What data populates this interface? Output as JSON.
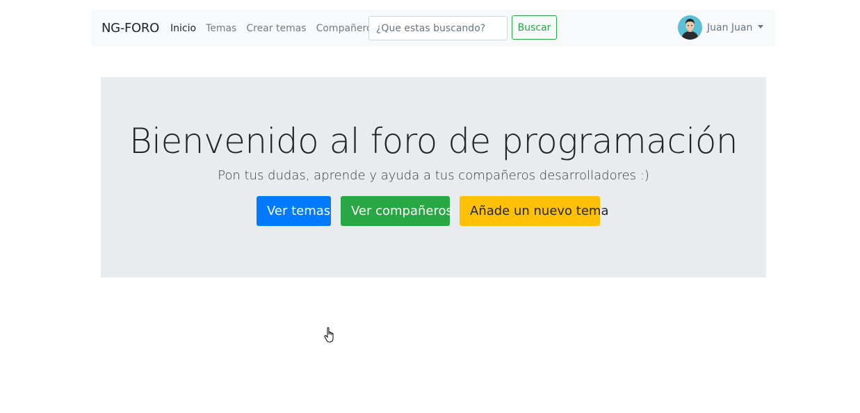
{
  "navbar": {
    "brand": "NG-FORO",
    "links": [
      {
        "label": "Inicio"
      },
      {
        "label": "Temas"
      },
      {
        "label": "Crear temas"
      },
      {
        "label": "Compañeros"
      }
    ],
    "search": {
      "placeholder": "¿Que estas buscando?",
      "value": "",
      "button_label": "Buscar"
    },
    "user": {
      "name": "Juan Juan",
      "avatar_icon": "user-avatar-icon",
      "menu_icon": "caret-down-icon"
    }
  },
  "jumbotron": {
    "title": "Bienvenido al foro de programación",
    "subtitle": "Pon tus dudas, aprende y ayuda a tus compañeros desarrolladores :)",
    "buttons": [
      {
        "label": "Ver temas"
      },
      {
        "label": "Ver compañeros"
      },
      {
        "label": "Añade un nuevo tema"
      }
    ]
  },
  "colors": {
    "primary": "#007bff",
    "success": "#28a745",
    "warning": "#ffc107",
    "navbar_bg": "#f8f9fa",
    "jumbotron_bg": "#e9ecef"
  }
}
